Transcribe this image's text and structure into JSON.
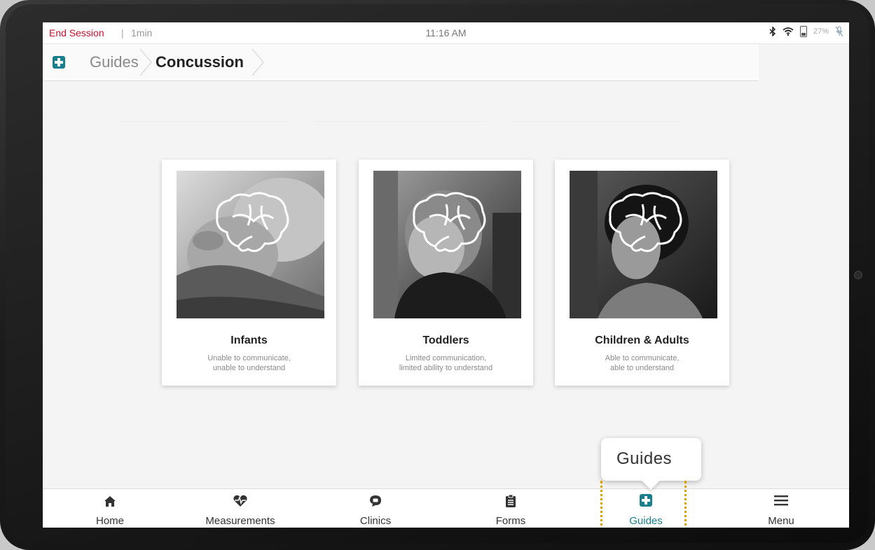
{
  "status_bar": {
    "end_session": "End Session",
    "separator": "|",
    "duration": "1min",
    "time": "11:16 AM",
    "battery_percent": "27%"
  },
  "breadcrumb": {
    "root": "Guides",
    "current": "Concussion"
  },
  "cards": [
    {
      "title": "Infants",
      "desc_line1": "Unable to communicate,",
      "desc_line2": "unable to understand"
    },
    {
      "title": "Toddlers",
      "desc_line1": "Limited communication,",
      "desc_line2": "limited ability to understand"
    },
    {
      "title": "Children & Adults",
      "desc_line1": "Able to communicate,",
      "desc_line2": "able to understand"
    }
  ],
  "nav": {
    "items": [
      {
        "label": "Home",
        "icon": "home-icon"
      },
      {
        "label": "Measurements",
        "icon": "heart-pulse-icon"
      },
      {
        "label": "Clinics",
        "icon": "chat-icon"
      },
      {
        "label": "Forms",
        "icon": "clipboard-icon"
      },
      {
        "label": "Guides",
        "icon": "medical-cross-icon"
      },
      {
        "label": "Menu",
        "icon": "hamburger-icon"
      }
    ],
    "active": "Guides"
  },
  "tooltip": {
    "text": "Guides"
  },
  "colors": {
    "accent": "#1a7f8c",
    "end_session": "#c8102e",
    "highlight": "#e0a100"
  }
}
